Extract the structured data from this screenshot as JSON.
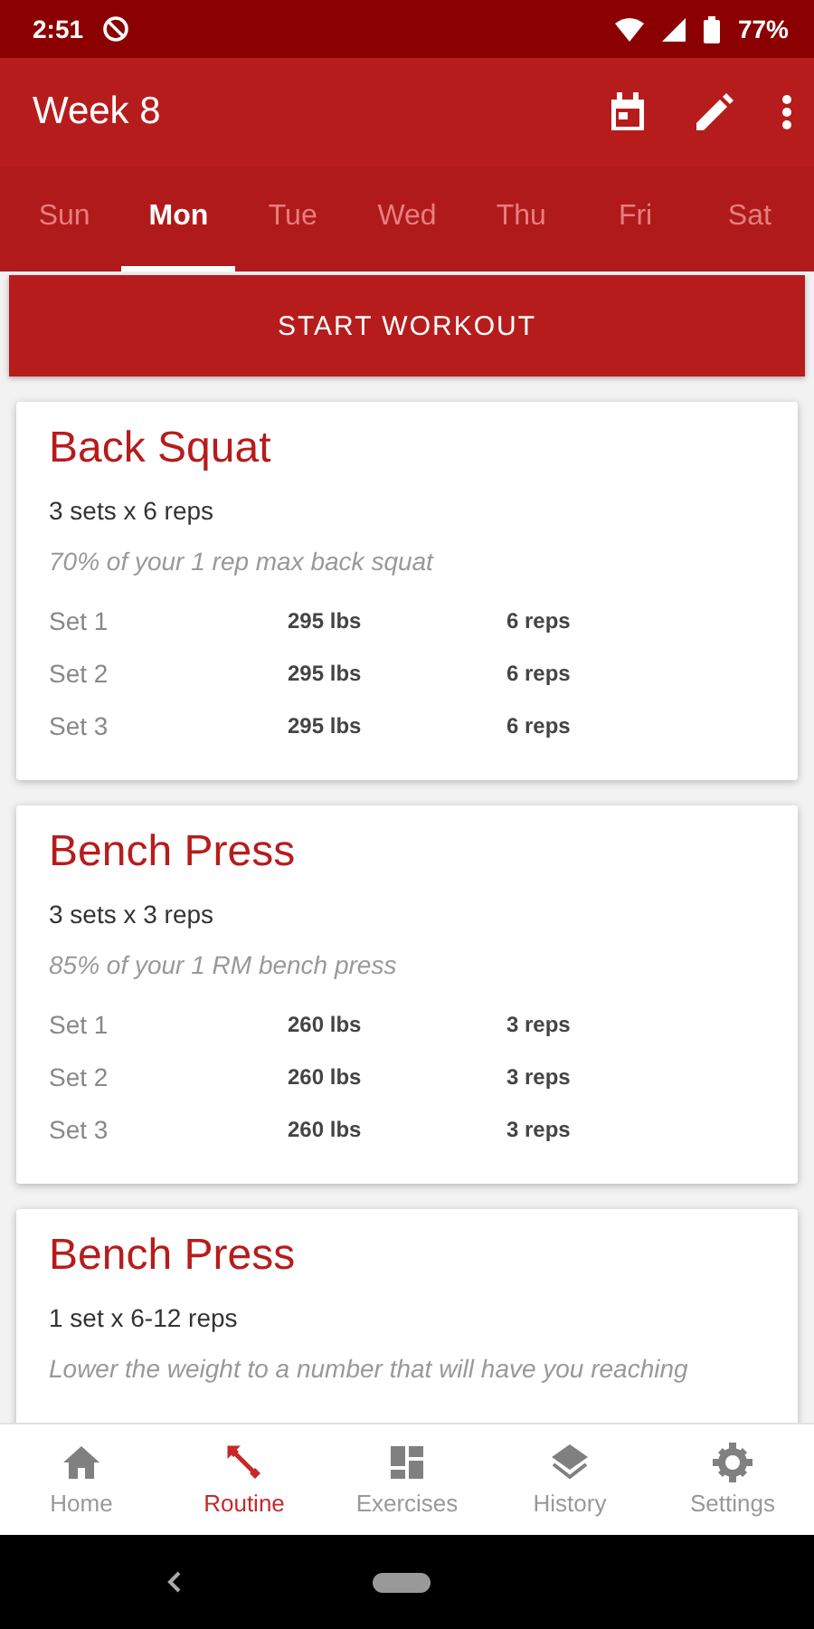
{
  "status_bar": {
    "time": "2:51",
    "battery": "77%"
  },
  "app_bar": {
    "title": "Week 8"
  },
  "tabs": [
    {
      "label": "Sun",
      "selected": false
    },
    {
      "label": "Mon",
      "selected": true
    },
    {
      "label": "Tue",
      "selected": false
    },
    {
      "label": "Wed",
      "selected": false
    },
    {
      "label": "Thu",
      "selected": false
    },
    {
      "label": "Fri",
      "selected": false
    },
    {
      "label": "Sat",
      "selected": false
    }
  ],
  "start_button": "START WORKOUT",
  "exercises": [
    {
      "name": "Back Squat",
      "scheme": "3 sets x 6 reps",
      "note": "70% of your 1 rep max back squat",
      "sets": [
        {
          "set": "Set 1",
          "weight": "295 lbs",
          "reps": "6 reps"
        },
        {
          "set": "Set 2",
          "weight": "295 lbs",
          "reps": "6 reps"
        },
        {
          "set": "Set 3",
          "weight": "295 lbs",
          "reps": "6 reps"
        }
      ]
    },
    {
      "name": "Bench Press",
      "scheme": "3 sets x 3 reps",
      "note": "85% of your 1 RM bench press",
      "sets": [
        {
          "set": "Set 1",
          "weight": "260 lbs",
          "reps": "3 reps"
        },
        {
          "set": "Set 2",
          "weight": "260 lbs",
          "reps": "3 reps"
        },
        {
          "set": "Set 3",
          "weight": "260 lbs",
          "reps": "3 reps"
        }
      ]
    },
    {
      "name": "Bench Press",
      "scheme": "1 set x 6-12 reps",
      "note": "Lower the weight to a number that will have you reaching"
    }
  ],
  "bottom_nav": [
    {
      "kind": "home",
      "label": "Home",
      "selected": false
    },
    {
      "kind": "routine",
      "label": "Routine",
      "selected": true
    },
    {
      "kind": "exercises",
      "label": "Exercises",
      "selected": false
    },
    {
      "kind": "history",
      "label": "History",
      "selected": false
    },
    {
      "kind": "settings",
      "label": "Settings",
      "selected": false
    }
  ]
}
